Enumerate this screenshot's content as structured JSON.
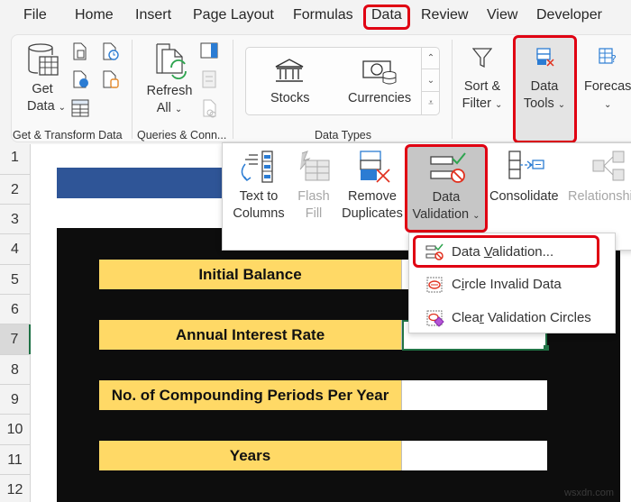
{
  "menu_tabs": [
    "File",
    "Home",
    "Insert",
    "Page Layout",
    "Formulas",
    "Data",
    "Review",
    "View",
    "Developer"
  ],
  "active_tab": "Data",
  "ribbon": {
    "get_transform": {
      "get_data_line1": "Get",
      "get_data_line2": "Data",
      "group_label": "Get & Transform Data"
    },
    "queries": {
      "refresh_line1": "Refresh",
      "refresh_line2": "All",
      "group_label": "Queries & Conn..."
    },
    "data_types": {
      "stocks": "Stocks",
      "currencies": "Currencies",
      "group_label": "Data Types"
    },
    "sort_filter_line1": "Sort &",
    "sort_filter_line2": "Filter",
    "data_tools_line1": "Data",
    "data_tools_line2": "Tools",
    "forecast": "Forecast"
  },
  "data_tools_panel": {
    "text_to_columns_line1": "Text to",
    "text_to_columns_line2": "Columns",
    "flash_fill_line1": "Flash",
    "flash_fill_line2": "Fill",
    "remove_duplicates_line1": "Remove",
    "remove_duplicates_line2": "Duplicates",
    "data_validation_line1": "Data",
    "data_validation_line2": "Validation",
    "consolidate": "Consolidate",
    "relationships": "Relationships"
  },
  "validation_menu": {
    "items": [
      {
        "pre": "Data ",
        "u": "V",
        "post": "alidation..."
      },
      {
        "pre": "C",
        "u": "i",
        "post": "rcle Invalid Data"
      },
      {
        "pre": "Clea",
        "u": "r",
        "post": " Validation Circles"
      }
    ]
  },
  "row_numbers": [
    "1",
    "2",
    "3",
    "4",
    "5",
    "6",
    "7",
    "8",
    "9",
    "10",
    "11",
    "12"
  ],
  "selected_row": "7",
  "sheet": {
    "labels": [
      "Initial Balance",
      "Annual Interest Rate",
      "No. of Compounding Periods Per Year",
      "Years"
    ]
  },
  "watermark": "wsxdn.com",
  "colors": {
    "highlight_red": "#e00012",
    "header_blue": "#2f5597",
    "label_yellow": "#ffd966",
    "background_black": "#0d0d0d",
    "excel_green": "#217346"
  }
}
